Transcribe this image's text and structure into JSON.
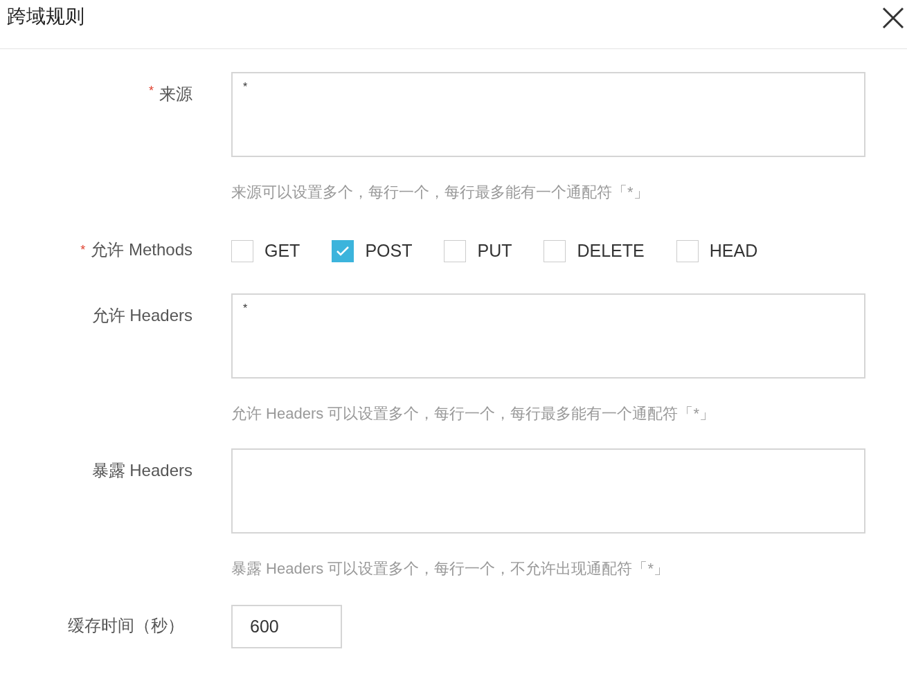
{
  "dialog": {
    "title": "跨域规则"
  },
  "fields": [
    {
      "kind": "textarea",
      "label": "来源",
      "required": true,
      "value": "*",
      "help": "来源可以设置多个，每行一个，每行最多能有一个通配符「*」"
    },
    {
      "kind": "checkboxes",
      "label": "允许 Methods",
      "required": true,
      "options": [
        {
          "label": "GET",
          "checked": false
        },
        {
          "label": "POST",
          "checked": true
        },
        {
          "label": "PUT",
          "checked": false
        },
        {
          "label": "DELETE",
          "checked": false
        },
        {
          "label": "HEAD",
          "checked": false
        }
      ]
    },
    {
      "kind": "textarea",
      "label": "允许 Headers",
      "required": false,
      "value": "*",
      "help": "允许 Headers 可以设置多个，每行一个，每行最多能有一个通配符「*」"
    },
    {
      "kind": "textarea",
      "label": "暴露 Headers",
      "required": false,
      "help": "暴露 Headers 可以设置多个，每行一个，不允许出现通配符「*」"
    },
    {
      "kind": "input",
      "label": "缓存时间（秒）",
      "required": false,
      "value": "600"
    }
  ]
}
